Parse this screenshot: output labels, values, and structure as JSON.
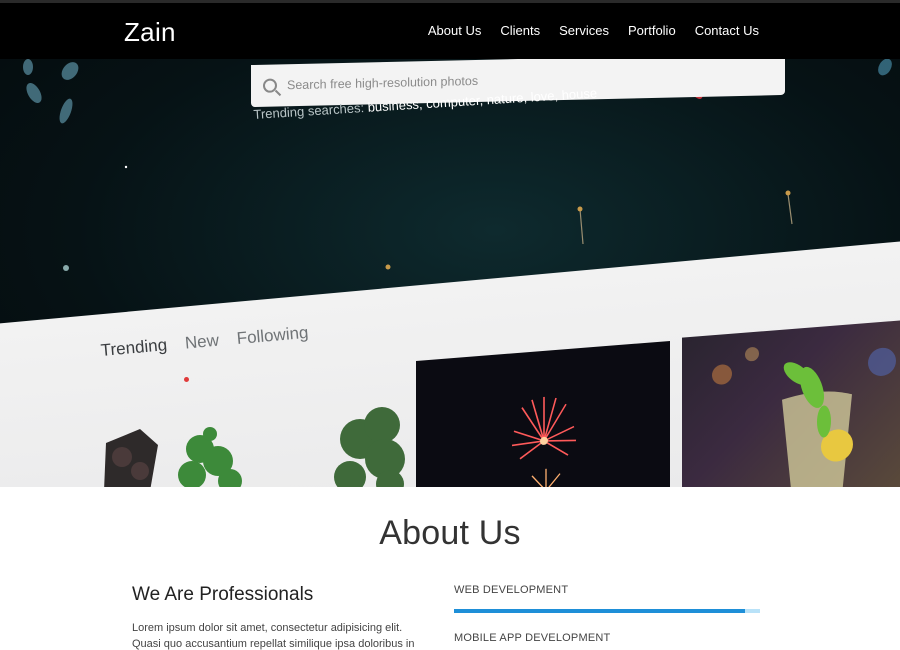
{
  "navbar": {
    "brand": "Zain",
    "links": [
      "About Us",
      "Clients",
      "Services",
      "Portfolio",
      "Contact Us"
    ]
  },
  "hero": {
    "search_placeholder": "Search free high-resolution photos",
    "trending_label": "Trending searches:",
    "trending_terms": "business, computer, nature, love, house",
    "tabs": [
      "Trending",
      "New",
      "Following"
    ]
  },
  "about": {
    "title": "About Us",
    "heading": "We Are Professionals",
    "paragraph": "Lorem ipsum dolor sit amet, consectetur adipisicing elit. Quasi quo accusantium repellat similique ipsa doloribus in aliquam earum eaque",
    "skills": [
      {
        "label": "WEB DEVELOPMENT",
        "progress": 0.95
      },
      {
        "label": "MOBILE APP DEVELOPMENT"
      }
    ]
  },
  "colors": {
    "navbar": "#000000",
    "progress_fill": "#1e8fd8",
    "progress_track": "#b9e2f8",
    "tab_dot": "#e03a3a"
  }
}
